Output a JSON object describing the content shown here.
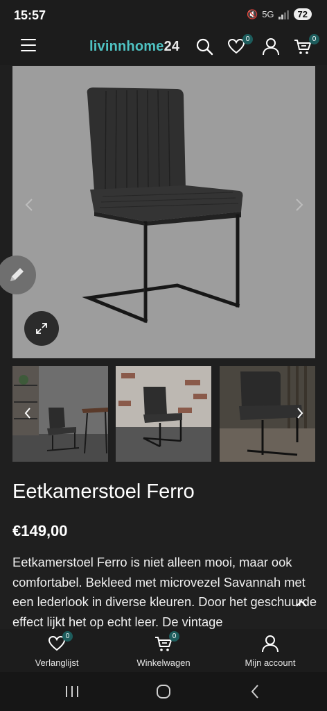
{
  "status": {
    "time": "15:57",
    "network": "5G",
    "battery": "72"
  },
  "header": {
    "logo_part1": "livinnhome",
    "logo_part2": "24",
    "wishlist_count": "0",
    "cart_count": "0",
    "icons": [
      "menu-icon",
      "search-icon",
      "heart-icon",
      "user-icon",
      "cart-icon"
    ]
  },
  "product": {
    "title": "Eetkamerstoel Ferro",
    "price": "€149,00",
    "description": "Eetkamerstoel Ferro is niet alleen mooi, maar ook comfortabel. Bekleed met microvezel Savannah met een lederlook in diverse kleuren. Door het geschuurde effect lijkt het op echt leer. De vintage"
  },
  "bottom_nav": {
    "items": [
      {
        "label": "Verlanglijst",
        "icon": "heart-icon",
        "badge": "0"
      },
      {
        "label": "Winkelwagen",
        "icon": "cart-icon",
        "badge": "0"
      },
      {
        "label": "Mijn account",
        "icon": "user-icon"
      }
    ]
  },
  "colors": {
    "accent": "#4fc3c3",
    "badge": "#1d5c5c",
    "background": "#1f1f1f"
  }
}
